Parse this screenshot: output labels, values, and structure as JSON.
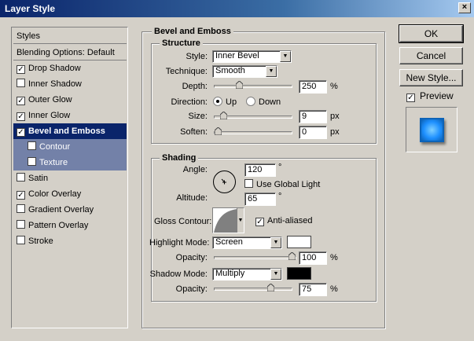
{
  "window": {
    "title": "Layer Style",
    "close": "×"
  },
  "left_panel": {
    "header": "Styles",
    "blending": "Blending Options: Default",
    "items": [
      {
        "label": "Drop Shadow",
        "checked": "✓"
      },
      {
        "label": "Inner Shadow",
        "checked": ""
      },
      {
        "label": "Outer Glow",
        "checked": "✓"
      },
      {
        "label": "Inner Glow",
        "checked": "✓"
      },
      {
        "label": "Bevel and Emboss",
        "checked": "✓"
      },
      {
        "label": "Contour",
        "checked": ""
      },
      {
        "label": "Texture",
        "checked": ""
      },
      {
        "label": "Satin",
        "checked": ""
      },
      {
        "label": "Color Overlay",
        "checked": "✓"
      },
      {
        "label": "Gradient Overlay",
        "checked": ""
      },
      {
        "label": "Pattern Overlay",
        "checked": ""
      },
      {
        "label": "Stroke",
        "checked": ""
      }
    ]
  },
  "bevel": {
    "group_title": "Bevel and Emboss",
    "structure": {
      "title": "Structure",
      "style_label": "Style:",
      "style_value": "Inner Bevel",
      "technique_label": "Technique:",
      "technique_value": "Smooth",
      "depth_label": "Depth:",
      "depth_value": "250",
      "depth_unit": "%",
      "depth_pos": 0.3,
      "direction_label": "Direction:",
      "dir_up": "Up",
      "dir_down": "Down",
      "size_label": "Size:",
      "size_value": "9",
      "size_unit": "px",
      "size_pos": 0.08,
      "soften_label": "Soften:",
      "soften_value": "0",
      "soften_unit": "px",
      "soften_pos": 0.0
    },
    "shading": {
      "title": "Shading",
      "angle_label": "Angle:",
      "angle_value": "120",
      "angle_unit": "°",
      "global_light": "Use Global Light",
      "altitude_label": "Altitude:",
      "altitude_value": "65",
      "altitude_unit": "°",
      "gloss_label": "Gloss Contour:",
      "anti_aliased": "Anti-aliased",
      "highlight_label": "Highlight Mode:",
      "highlight_value": "Screen",
      "highlight_color": "#ffffff",
      "hopacity_label": "Opacity:",
      "hopacity_value": "100",
      "hopacity_unit": "%",
      "hopacity_pos": 1.0,
      "shadow_label": "Shadow Mode:",
      "shadow_value": "Multiply",
      "shadow_color": "#000000",
      "sopacity_label": "Opacity:",
      "sopacity_value": "75",
      "sopacity_unit": "%",
      "sopacity_pos": 0.75
    }
  },
  "buttons": {
    "ok": "OK",
    "cancel": "Cancel",
    "new_style": "New Style...",
    "preview": "Preview"
  },
  "colors": {
    "title_start": "#0a246a",
    "selection": "#0a246a",
    "sub_selection": "#7381a8",
    "preview_blue": "#1e90ff"
  }
}
